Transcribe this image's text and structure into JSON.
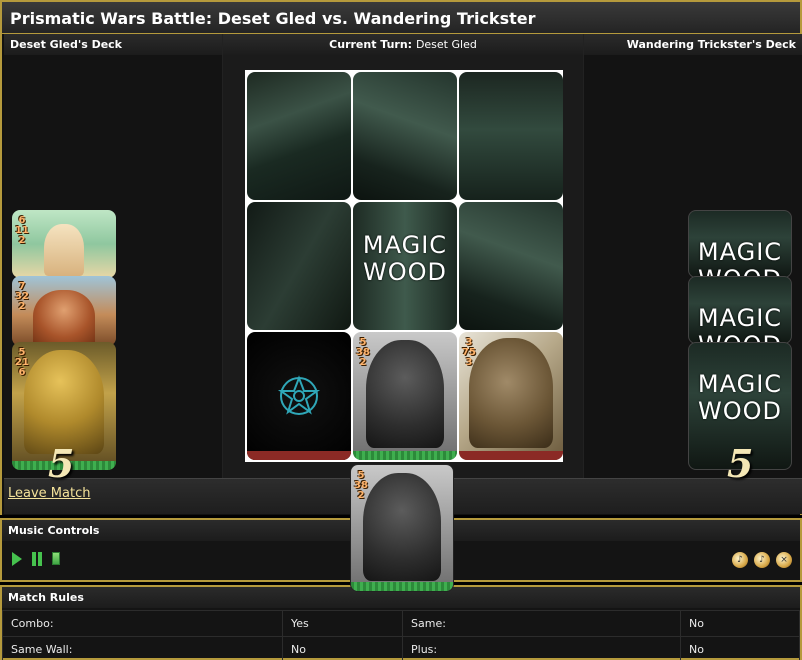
{
  "window": {
    "title": "Prismatic Wars Battle: Deset Gled vs. Wandering Trickster"
  },
  "left_deck": {
    "header": "Deset Gled's Deck",
    "score": "5",
    "cards": [
      {
        "name": "fairy",
        "stats": [
          "6",
          "11",
          "2"
        ]
      },
      {
        "name": "dwarf",
        "stats": [
          "7",
          "32",
          "2"
        ]
      },
      {
        "name": "ape",
        "stats": [
          "5",
          "21",
          "6"
        ]
      }
    ]
  },
  "center": {
    "turn_label": "Current Turn:",
    "turn_name": "Deset Gled"
  },
  "right_deck": {
    "header": "Wandering Trickster's Deck",
    "score": "5",
    "card_back_text": [
      "MAGIC",
      "WOOD"
    ]
  },
  "board": {
    "center_logo": [
      "MAGIC",
      "WOOD"
    ],
    "golem_stats": [
      "5",
      "38",
      "2"
    ],
    "tree_stats": [
      "3",
      "75",
      "3"
    ]
  },
  "floating_card": {
    "stats": [
      "5",
      "38",
      "2"
    ]
  },
  "footer": {
    "leave_match": "Leave Match"
  },
  "music": {
    "title": "Music Controls",
    "buttons": [
      "play",
      "pause",
      "stop"
    ],
    "volume_icons": [
      "volume-up",
      "volume-down",
      "mute"
    ]
  },
  "rules": {
    "title": "Match Rules",
    "rows": [
      {
        "label1": "Combo:",
        "value1": "Yes",
        "label2": "Same:",
        "value2": "No"
      },
      {
        "label1": "Same Wall:",
        "value1": "No",
        "label2": "Plus:",
        "value2": "No"
      }
    ]
  },
  "colors": {
    "accent_border": "#b59a3c",
    "owner_green": "#3fae4f",
    "owner_red": "#8b2a25",
    "score_text": "#f4e7b5",
    "link": "#f4e29a"
  }
}
